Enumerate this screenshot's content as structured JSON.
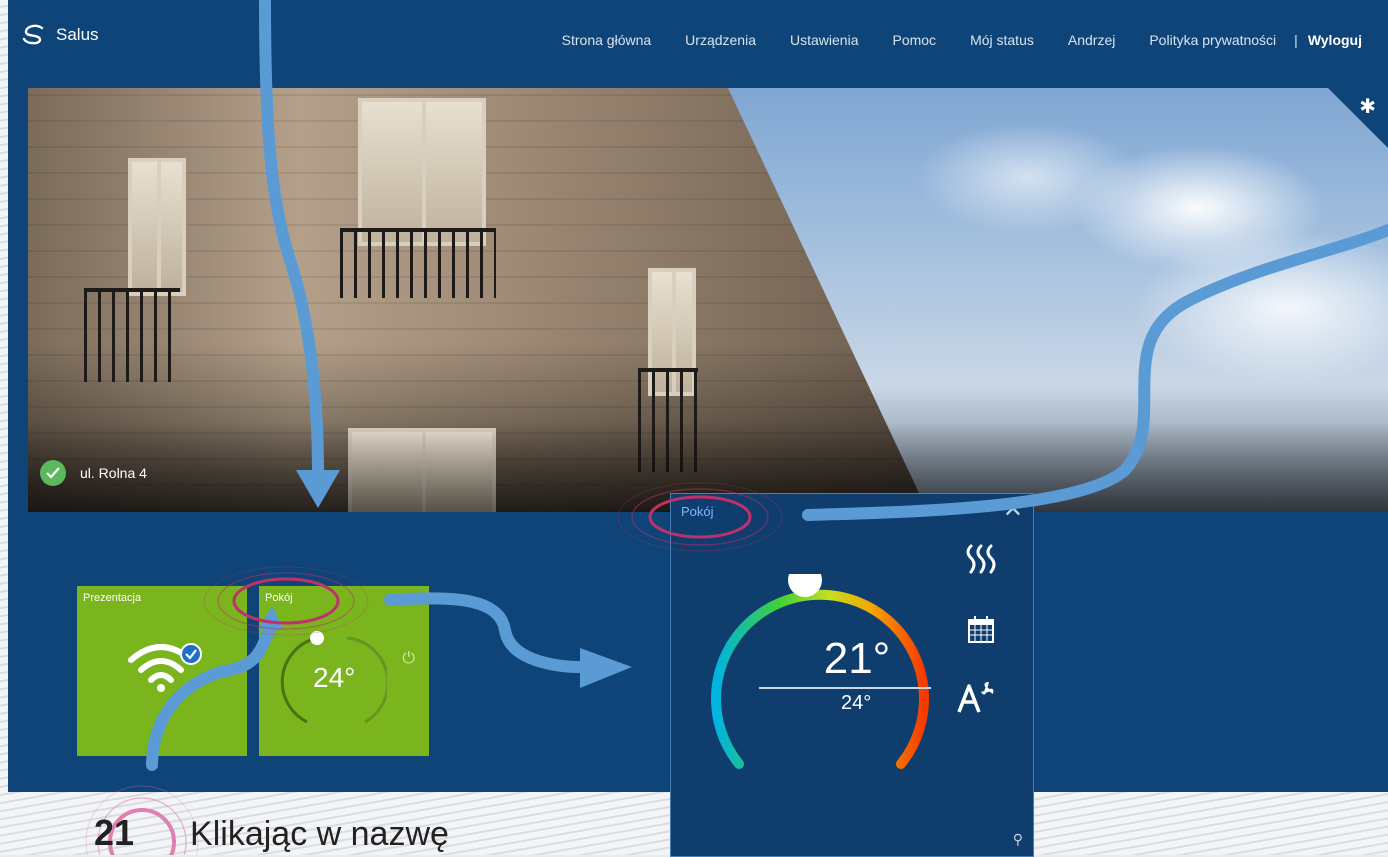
{
  "app": {
    "name": "Salus"
  },
  "nav": {
    "items": [
      "Strona główna",
      "Urządzenia",
      "Ustawienia",
      "Pomoc",
      "Mój status",
      "Andrzej",
      "Polityka prywatności"
    ],
    "separator": "|",
    "logout": "Wyloguj"
  },
  "hero": {
    "address": "ul. Rolna 4",
    "status": "ok"
  },
  "tiles": [
    {
      "title": "Prezentacja",
      "icon": "wifi-icon"
    },
    {
      "title": "Pokój",
      "temperature": "24°",
      "icon": "power-icon"
    }
  ],
  "popup": {
    "title": "Pokój",
    "current_temperature": "21°",
    "set_temperature": "24°",
    "modes": [
      "heating-icon",
      "calendar-icon",
      "auto-fan-icon"
    ],
    "close_label": "✕",
    "pin_label": "⚲"
  },
  "tutorial": {
    "step": "21",
    "text": "Klikając w nazwę"
  },
  "colors": {
    "brand_blue": "#0e4477",
    "tile_green": "#7ab51d",
    "accent_arrow": "#5b9bd5",
    "highlight_ring": "#c0306a"
  }
}
